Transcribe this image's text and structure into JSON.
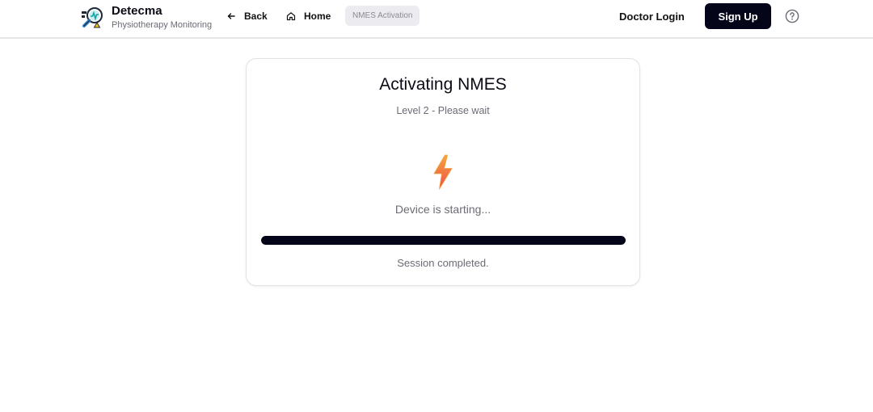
{
  "brand": {
    "name": "Detecma",
    "subtitle": "Physiotherapy Monitoring",
    "logo_icon": "magnifier-chart-logo-icon"
  },
  "nav": {
    "back_label": "Back",
    "back_icon": "arrow-left-icon",
    "home_label": "Home",
    "home_icon": "home-icon",
    "current_page": "NMES Activation"
  },
  "auth": {
    "doctor_login_label": "Doctor Login",
    "signup_label": "Sign Up"
  },
  "help_icon": "help-circle-icon",
  "card": {
    "title": "Activating NMES",
    "subtitle": "Level 2 - Please wait",
    "icon": "lightning-bolt-icon",
    "status_text": "Device is starting...",
    "progress_percent": 100,
    "session_text": "Session completed."
  },
  "colors": {
    "accent_dark": "#05051a",
    "bolt_top": "#f6a83a",
    "bolt_bottom": "#ee4b4b",
    "muted_text": "#6b6b75",
    "pill_bg": "#ececf0"
  }
}
